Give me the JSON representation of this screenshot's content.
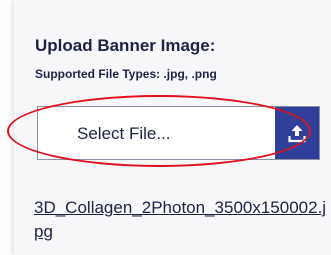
{
  "upload_section": {
    "title": "Upload Banner Image:",
    "supported_types": "Supported File Types: .jpg, .png",
    "file_picker": {
      "placeholder": "Select File...",
      "button_icon": "upload-icon"
    },
    "uploaded_file": "3D_Collagen_2Photon_3500x150002.jpg"
  },
  "colors": {
    "text": "#1e2346",
    "button": "#2f3f9a",
    "highlight": "#e0101d",
    "panel_bg": "#f8f8fb"
  }
}
